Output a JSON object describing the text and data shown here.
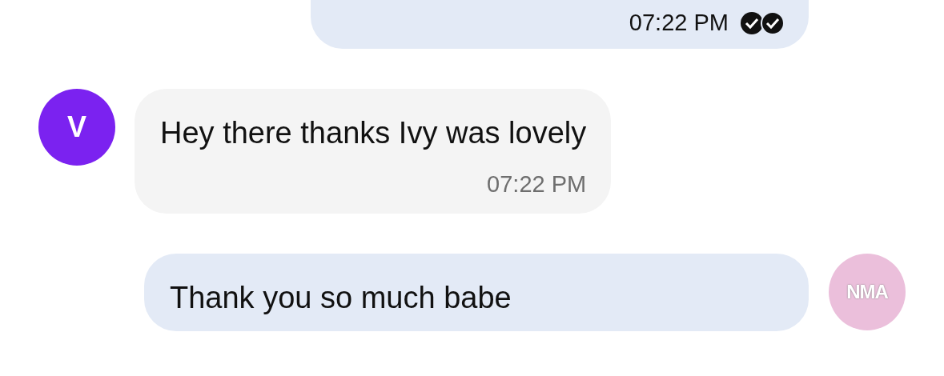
{
  "messages": [
    {
      "kind": "outgoing",
      "time": "07:22 PM",
      "read": true
    },
    {
      "kind": "incoming",
      "avatar": {
        "letter": "V",
        "color": "#7b22f0"
      },
      "text": "Hey there thanks Ivy was lovely",
      "time": "07:22 PM"
    },
    {
      "kind": "outgoing",
      "avatar": {
        "letter": "NMA",
        "color": "#ebbfdb"
      },
      "text": "Thank you so much babe"
    }
  ]
}
